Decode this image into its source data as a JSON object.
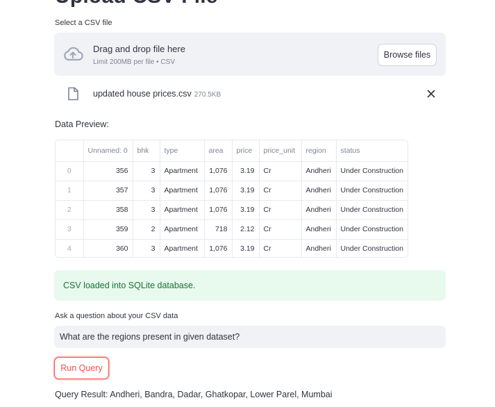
{
  "page": {
    "title": "Upload CSV File"
  },
  "uploader": {
    "label": "Select a CSV file",
    "drop_text": "Drag and drop file here",
    "limit_text": "Limit 200MB per file • CSV",
    "browse_label": "Browse files",
    "icon": "cloud-upload-icon"
  },
  "uploaded_file": {
    "name": "updated house prices.csv",
    "size": "270.5KB",
    "icon": "file-icon",
    "remove_icon": "close-icon"
  },
  "preview": {
    "label": "Data Preview:",
    "columns": [
      "",
      "Unnamed: 0",
      "bhk",
      "type",
      "area",
      "price",
      "price_unit",
      "region",
      "status"
    ],
    "rows": [
      [
        "0",
        "356",
        "3",
        "Apartment",
        "1,076",
        "3.19",
        "Cr",
        "Andheri",
        "Under Construction"
      ],
      [
        "1",
        "357",
        "3",
        "Apartment",
        "1,076",
        "3.19",
        "Cr",
        "Andheri",
        "Under Construction"
      ],
      [
        "2",
        "358",
        "3",
        "Apartment",
        "1,076",
        "3.19",
        "Cr",
        "Andheri",
        "Under Construction"
      ],
      [
        "3",
        "359",
        "2",
        "Apartment",
        "718",
        "2.12",
        "Cr",
        "Andheri",
        "Under Construction"
      ],
      [
        "4",
        "360",
        "3",
        "Apartment",
        "1,076",
        "3.19",
        "Cr",
        "Andheri",
        "Under Construction"
      ]
    ]
  },
  "status": {
    "success_text": "CSV loaded into SQLite database."
  },
  "question": {
    "label": "Ask a question about your CSV data",
    "value": "What are the regions present in given dataset?"
  },
  "actions": {
    "run_label": "Run Query"
  },
  "result": {
    "text": "Query Result: Andheri, Bandra, Dadar, Ghatkopar, Lower Parel, Mumbai"
  },
  "colors": {
    "primary": "#ff4b4b",
    "success_bg": "#e8f9ee",
    "success_text": "#177233",
    "widget_bg": "#f0f2f6"
  }
}
